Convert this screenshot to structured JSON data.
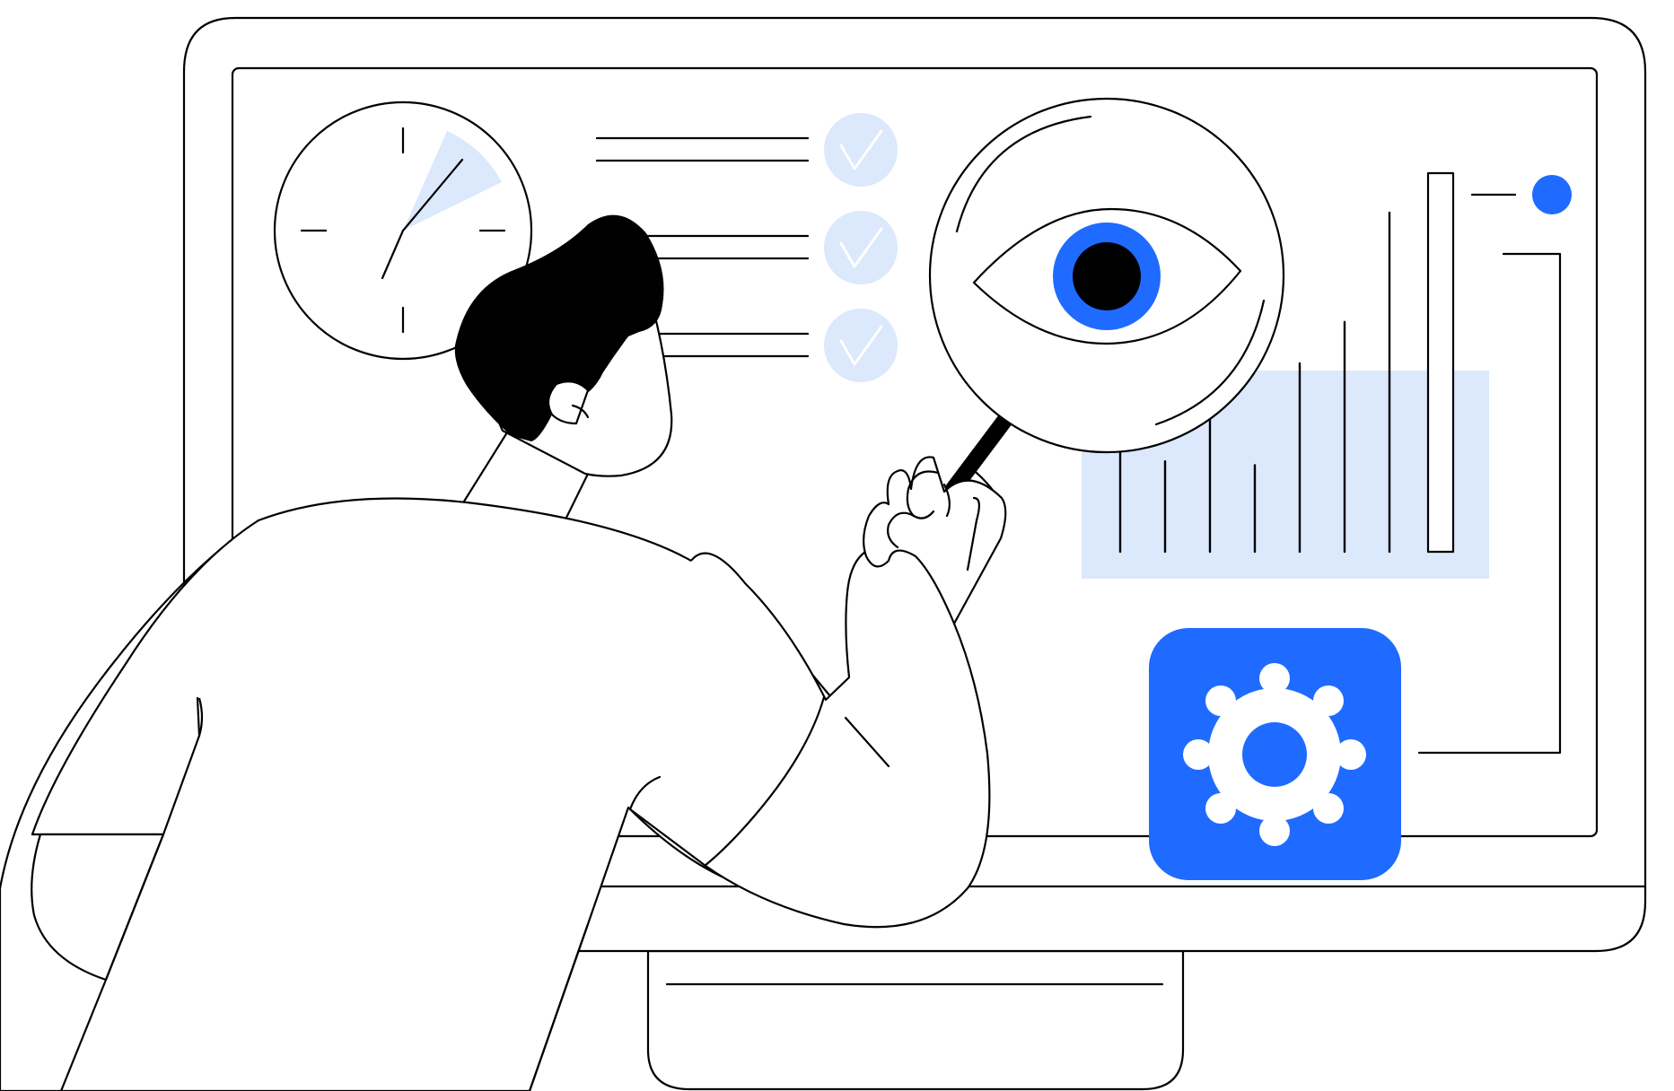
{
  "illustration": {
    "subject": "person-with-magnifier-at-monitor",
    "colors": {
      "accent": "#1F6BFF",
      "accent_light": "#DCE8FC",
      "ink": "#000000",
      "background": "#FFFFFF"
    },
    "icons": [
      "clock-icon",
      "checkmark-icon",
      "eye-icon",
      "magnifying-glass-icon",
      "gear-icon",
      "bar-chart-icon"
    ],
    "checklist": {
      "items": [
        {
          "checked": true
        },
        {
          "checked": true
        },
        {
          "checked": true
        }
      ]
    },
    "bar_chart": {
      "relative_values": [
        0.34,
        0.24,
        0.37,
        0.23,
        0.5,
        0.61,
        0.9
      ]
    }
  }
}
